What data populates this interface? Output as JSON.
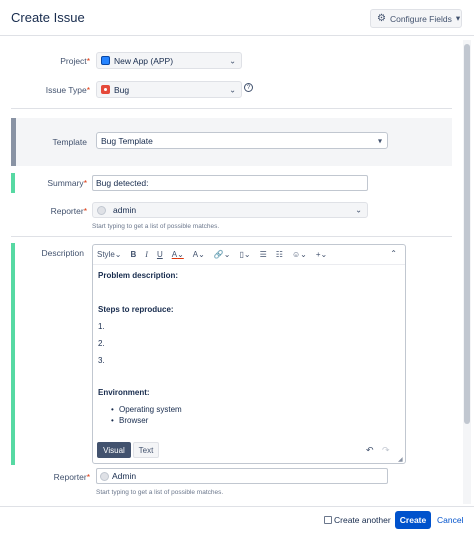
{
  "dialog": {
    "title": "Create Issue",
    "configure_fields_label": "Configure Fields",
    "configure_fields_chevron": "▾"
  },
  "project": {
    "label": "Project",
    "value": "New App (APP)"
  },
  "issue_type": {
    "label": "Issue Type",
    "value": "Bug",
    "help": "?"
  },
  "template": {
    "label": "Template",
    "value": "Bug Template"
  },
  "summary": {
    "label": "Summary",
    "value": "Bug detected:"
  },
  "reporter_top": {
    "label": "Reporter",
    "value": "admin",
    "hint": "Start typing to get a list of possible matches."
  },
  "description": {
    "label": "Description",
    "toolbar": {
      "style": "Style",
      "bold": "B",
      "italic": "I",
      "underline": "U",
      "color": "A"
    },
    "content": {
      "problem": "Problem description:",
      "steps": "Steps to reproduce:",
      "step1": "1.",
      "step2": "2.",
      "step3": "3.",
      "environment": "Environment:",
      "env_item1": "Operating system",
      "env_item2": "Browser"
    },
    "mode_visual": "Visual",
    "mode_text": "Text"
  },
  "reporter_bottom": {
    "label": "Reporter",
    "value": "Admin",
    "hint": "Start typing to get a list of possible matches."
  },
  "footer": {
    "create_another": "Create another",
    "create": "Create",
    "cancel": "Cancel"
  },
  "colors": {
    "primary": "#0052cc",
    "accent_green": "#57d9a3",
    "required": "#de350b"
  }
}
